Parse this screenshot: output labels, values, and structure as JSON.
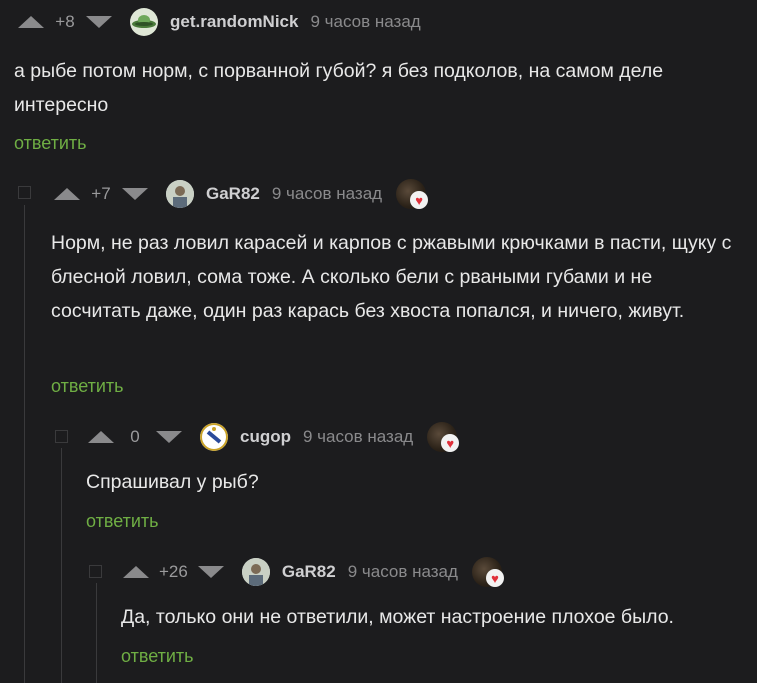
{
  "comments": [
    {
      "rating": "+8",
      "nick": "get.randomNick",
      "time": "9 часов назад",
      "text": "а рыбе потом норм, с порванной губой? я без подколов, на самом деле интересно",
      "reply": "ответить"
    },
    {
      "rating": "+7",
      "nick": "GaR82",
      "time": "9 часов назад",
      "text": "Норм, не раз ловил карасей и карпов с ржавыми крючками в пасти, щуку с блесной ловил, сома тоже. А сколько бели с рваными губами и не сосчитать даже, один раз карась без хвоста попался, и ничего, живут.",
      "reply": "ответить"
    },
    {
      "rating": "0",
      "nick": "cugop",
      "time": "9 часов назад",
      "text": "Спрашивал у рыб?",
      "reply": "ответить"
    },
    {
      "rating": "+26",
      "nick": "GaR82",
      "time": "9 часов назад",
      "text": "Да, только они не ответили, может настроение плохое было.",
      "reply": "ответить"
    }
  ],
  "colors": {
    "background": "#1c1c1e",
    "reply_link": "#6fae44",
    "heart": "#e0303a"
  },
  "icons": {
    "upvote": "triangle-up-icon",
    "downvote": "triangle-down-icon",
    "collapse": "collapse-square-icon",
    "award": "heart-badge-icon"
  }
}
